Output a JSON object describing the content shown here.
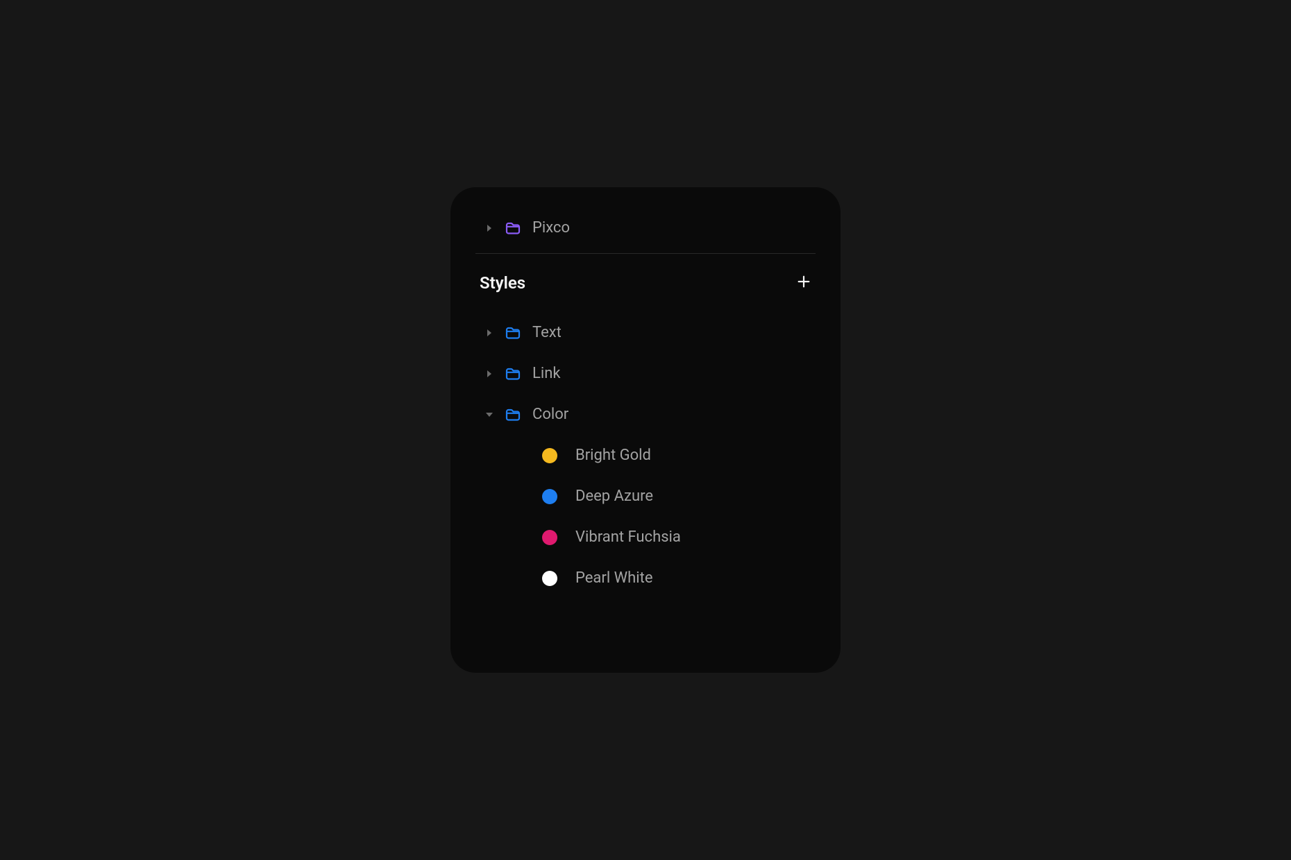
{
  "project": {
    "name": "Pixco",
    "folder_color": "#8b5cf6"
  },
  "section": {
    "title": "Styles"
  },
  "folders": [
    {
      "id": "text",
      "label": "Text",
      "expanded": false,
      "color": "#1e7ef0"
    },
    {
      "id": "link",
      "label": "Link",
      "expanded": false,
      "color": "#1e7ef0"
    },
    {
      "id": "color",
      "label": "Color",
      "expanded": true,
      "color": "#1e7ef0"
    }
  ],
  "swatches": [
    {
      "label": "Bright Gold",
      "hex": "#f5b91f"
    },
    {
      "label": "Deep Azure",
      "hex": "#1e7ef0"
    },
    {
      "label": "Vibrant Fuchsia",
      "hex": "#e01a6f"
    },
    {
      "label": "Pearl White",
      "hex": "#ffffff"
    }
  ]
}
